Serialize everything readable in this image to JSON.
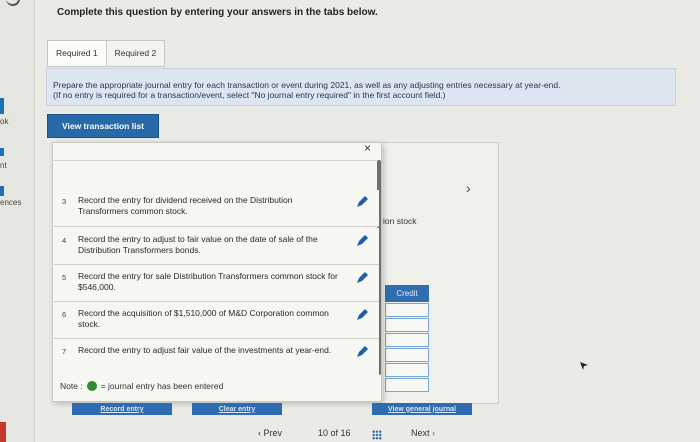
{
  "left_strip": {
    "labels": [
      "ok",
      "nt",
      "ences"
    ]
  },
  "instruction": "Complete this question by entering your answers in the tabs below.",
  "tabs": [
    {
      "label": "Required 1"
    },
    {
      "label": "Required 2"
    }
  ],
  "prompt": {
    "line1": "Prepare the appropriate journal entry for each transaction or event during 2021, as well as any adjusting entries necessary at year-end.",
    "line2": "(If no entry is required for a transaction/event, select \"No journal entry required\" in the first account field.)"
  },
  "view_button": "View transaction list",
  "close_icon": "×",
  "background": {
    "partial_text": "ion stock",
    "credit_header": "Credit",
    "chevron": "›"
  },
  "items": [
    {
      "num": "3",
      "text": "Record the entry for dividend received on the Distribution Transformers common stock."
    },
    {
      "num": "4",
      "text": "Record the entry to adjust to fair value on the date of sale of the Distribution Transformers bonds."
    },
    {
      "num": "5",
      "text": "Record the entry for sale Distribution Transformers common stock for $546,000."
    },
    {
      "num": "6",
      "text": "Record the acquisition of $1,510,000 of M&D Corporation common stock."
    },
    {
      "num": "7",
      "text": "Record the entry to adjust fair value of the investments at year-end."
    }
  ],
  "note": {
    "prefix": "Note :",
    "suffix": "= journal entry has been entered"
  },
  "buttons": {
    "record": "Record entry",
    "clear": "Clear entry",
    "view_journal": "View general journal"
  },
  "pager": {
    "prev": "Prev",
    "position": "10 of 16",
    "next": "Next"
  },
  "colors": {
    "accent": "#2869a8",
    "entered_dot": "#2f8a2f",
    "prompt_bg": "#dde6f0"
  }
}
